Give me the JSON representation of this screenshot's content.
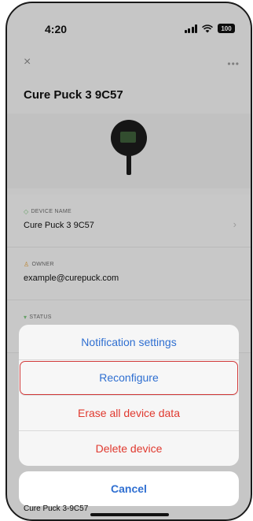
{
  "status_bar": {
    "time": "4:20",
    "battery": "100"
  },
  "header": {
    "close_symbol": "×",
    "more_symbol": "•••",
    "title": "Cure Puck 3 9C57"
  },
  "info": {
    "device_name": {
      "label": "DEVICE NAME",
      "value": "Cure Puck 3 9C57"
    },
    "owner": {
      "label": "OWNER",
      "value": "example@curepuck.com"
    },
    "status": {
      "label": "STATUS"
    }
  },
  "action_sheet": {
    "items": [
      {
        "label": "Notification settings",
        "color": "#2f6fd1"
      },
      {
        "label": "Reconfigure",
        "color": "#2f6fd1",
        "highlighted": true
      },
      {
        "label": "Erase all device data",
        "color": "#e0392f"
      },
      {
        "label": "Delete device",
        "color": "#e0392f"
      }
    ],
    "cancel_label": "Cancel"
  },
  "bottom_peek_text": "Cure Puck 3-9C57",
  "icons": {
    "close": "close-icon",
    "more": "more-icon",
    "chevron": "chevron-right-icon",
    "device_name_icon": "shield-icon",
    "owner_icon": "person-icon",
    "status_icon": "wifi-icon"
  }
}
